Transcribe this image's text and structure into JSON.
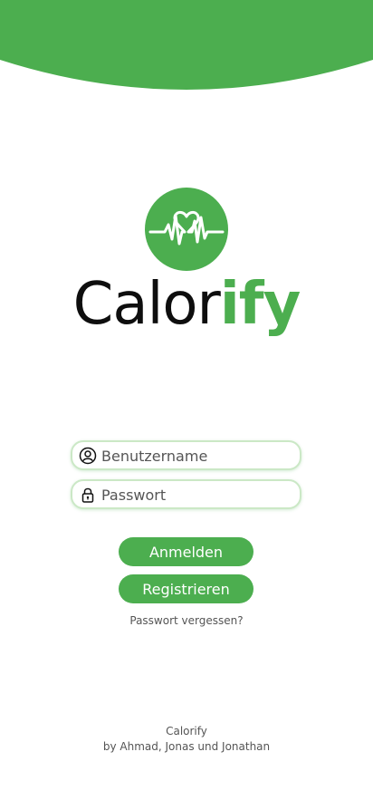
{
  "colors": {
    "brand_green": "#4cae4f",
    "field_border": "#cbe8c6",
    "text_dark": "#0e0e0e",
    "text_muted": "#555555"
  },
  "logo": {
    "icon": "heartbeat-heart-icon",
    "brand_part_a": "Calor",
    "brand_part_b": "ify"
  },
  "form": {
    "username": {
      "placeholder": "Benutzername",
      "value": "",
      "icon": "user-icon"
    },
    "password": {
      "placeholder": "Passwort",
      "value": "",
      "icon": "lock-icon"
    },
    "login_label": "Anmelden",
    "register_label": "Registrieren",
    "forgot_label": "Passwort vergessen?"
  },
  "footer": {
    "title": "Calorify",
    "subtitle": "by Ahmad, Jonas und Jonathan"
  }
}
